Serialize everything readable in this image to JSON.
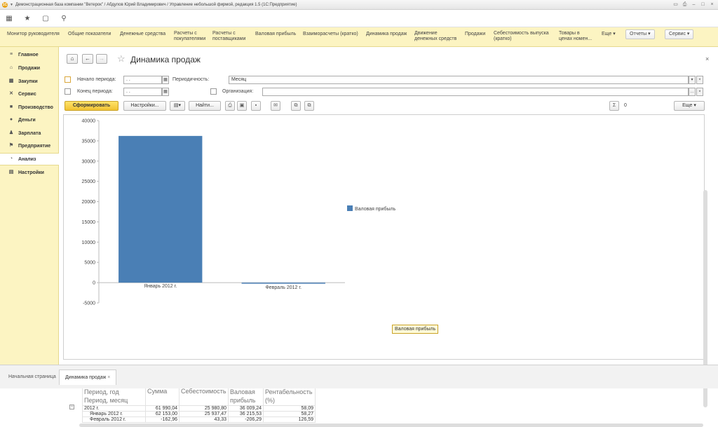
{
  "window": {
    "title": "Демонстрационная база компании \"Ветерок\" / Абдулов Юрий Владимирович / Управление небольшой фирмой, редакция 1.5 (1С:Предприятие)"
  },
  "sections": [
    {
      "label": "Монитор руководителя"
    },
    {
      "label": "Общие показатели"
    },
    {
      "label": "Денежные средства"
    },
    {
      "label": "Расчеты с покупателями"
    },
    {
      "label": "Расчеты с поставщиками"
    },
    {
      "label": "Валовая прибыль"
    },
    {
      "label": "Взаиморасчеты (кратко)"
    },
    {
      "label": "Динамика продаж"
    },
    {
      "label": "Движение денежных средств"
    },
    {
      "label": "Продажи"
    },
    {
      "label": "Себестоимость выпуска (кратко)"
    },
    {
      "label": "Товары в ценах номен..."
    }
  ],
  "section_buttons": {
    "more": "Еще",
    "reports": "Отчеты",
    "service": "Сервис"
  },
  "sidebar": [
    {
      "label": "Главное",
      "icon": "≡"
    },
    {
      "label": "Продажи",
      "icon": "⌂"
    },
    {
      "label": "Закупки",
      "icon": "▦"
    },
    {
      "label": "Сервис",
      "icon": "✕"
    },
    {
      "label": "Производство",
      "icon": "■"
    },
    {
      "label": "Деньги",
      "icon": "●"
    },
    {
      "label": "Зарплата",
      "icon": "♟"
    },
    {
      "label": "Предприятие",
      "icon": "⚑"
    },
    {
      "label": "Анализ",
      "icon": "◔"
    },
    {
      "label": "Настройки",
      "icon": "▤"
    }
  ],
  "page": {
    "title": "Динамика продаж"
  },
  "filters": {
    "period_start_label": "Начало периода:",
    "period_end_label": "Конец периода:",
    "period_start_value": " .  .",
    "period_end_value": " .  .",
    "periodicity_label": "Периодичность:",
    "periodicity_value": "Месяц",
    "organization_label": "Организация:",
    "organization_value": ""
  },
  "actions": {
    "generate": "Сформировать",
    "settings": "Настройки...",
    "find": "Найти...",
    "sum_value": "0",
    "more": "Еще"
  },
  "tooltip": "Валовая прибыль",
  "chart_data": {
    "type": "bar",
    "categories": [
      "Январь 2012 г.",
      "Февраль 2012 г."
    ],
    "series": [
      {
        "name": "Валовая прибыль",
        "values": [
          36215.53,
          -206.29
        ],
        "color": "#4a7fb5"
      }
    ],
    "ylim": [
      -5000,
      40000
    ],
    "yticks": [
      -5000,
      0,
      5000,
      10000,
      15000,
      20000,
      25000,
      30000,
      35000,
      40000
    ],
    "legend_position": "right",
    "grid": false
  },
  "table": {
    "headers": {
      "period_year": "Период, год",
      "period_month": "Период, месяц",
      "sum": "Сумма",
      "cost": "Себестоимость",
      "gross_profit": "Валовая прибыль",
      "profitability": "Рентабельность (%)"
    },
    "rows": [
      {
        "period": "2012 г.",
        "sum": "61 990,04",
        "cost": "25 980,80",
        "profit": "36 009,24",
        "rent": "58,09"
      },
      {
        "period": "Январь 2012 г.",
        "sum": "62 153,00",
        "cost": "25 937,47",
        "profit": "36 215,53",
        "rent": "58,27"
      },
      {
        "period": "Февраль 2012 г.",
        "sum": "-162,96",
        "cost": "43,33",
        "profit": "-206,29",
        "rent": "126,59"
      }
    ]
  },
  "bottom_tabs": [
    {
      "label": "Начальная страница"
    },
    {
      "label": "Динамика продаж"
    }
  ]
}
